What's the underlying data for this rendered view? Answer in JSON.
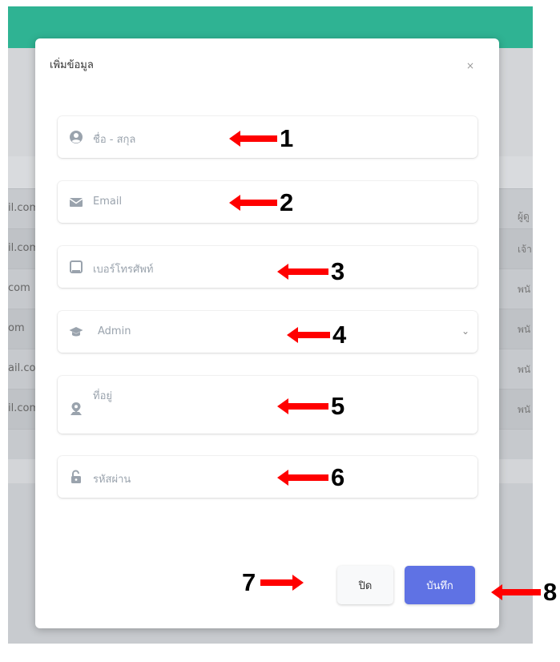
{
  "background": {
    "emails": [
      "il.com",
      "il.com",
      "com",
      "om",
      "ail.com",
      "il.com"
    ],
    "right_labels": [
      "ผู้ดู",
      "เจ้า",
      "พนั",
      "พนั",
      "พนั",
      "พนั"
    ]
  },
  "modal": {
    "title": "เพิ่มข้อมูล",
    "close_symbol": "×",
    "fields": {
      "name_placeholder": "ชื่อ - สกุล",
      "email_placeholder": "Email",
      "phone_placeholder": "เบอร์โทรศัพท์",
      "role_value": "Admin",
      "address_placeholder": "ที่อยู่",
      "password_placeholder": "รหัสผ่าน"
    },
    "buttons": {
      "close_label": "ปิด",
      "save_label": "บันทึก"
    }
  },
  "annotations": [
    "1",
    "2",
    "3",
    "4",
    "5",
    "6",
    "7",
    "8"
  ],
  "colors": {
    "header": "#2fb393",
    "primary": "#5f72e4",
    "arrow": "#ff0000",
    "icon": "#9aa3ad"
  }
}
